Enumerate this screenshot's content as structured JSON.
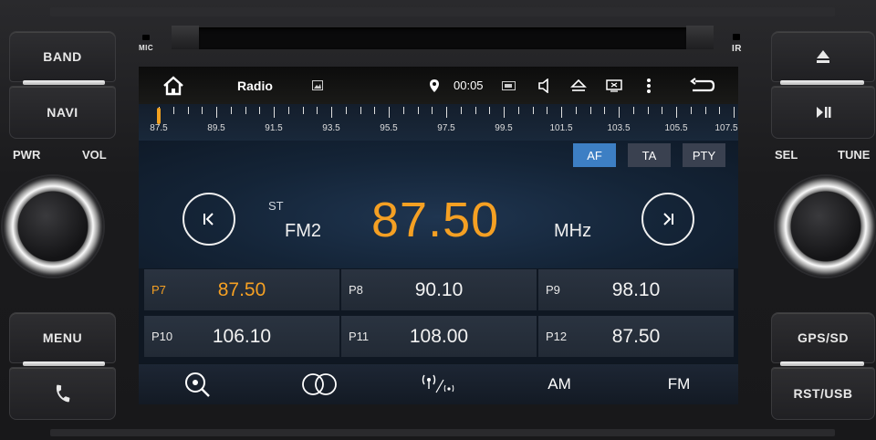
{
  "hardware": {
    "band": "BAND",
    "navi": "NAVI",
    "pwr": "PWR",
    "vol": "VOL",
    "menu": "MENU",
    "mic": "MIC",
    "ir": "IR",
    "sel": "SEL",
    "tune": "TUNE",
    "gps_sd": "GPS/SD",
    "rst_usb": "RST/USB",
    "eject_icon": "eject-icon",
    "play_pause_icon": "play-pause-icon",
    "phone_icon": "phone-icon"
  },
  "statusbar": {
    "title": "Radio",
    "time": "00:05",
    "icons": [
      "home-icon",
      "image-icon",
      "location-pin-icon",
      "battery-icon",
      "volume-icon",
      "eject-icon",
      "screen-icon",
      "more-icon",
      "back-icon"
    ]
  },
  "dial": {
    "labels": [
      "87.5",
      "89.5",
      "91.5",
      "93.5",
      "95.5",
      "97.5",
      "99.5",
      "101.5",
      "103.5",
      "105.5",
      "107.5"
    ]
  },
  "tags": {
    "af": "AF",
    "ta": "TA",
    "pty": "PTY"
  },
  "tuner": {
    "stereo": "ST",
    "band": "FM2",
    "frequency": "87.50",
    "unit": "MHz"
  },
  "presets": [
    {
      "num": "P7",
      "freq": "87.50",
      "active": true
    },
    {
      "num": "P8",
      "freq": "90.10",
      "active": false
    },
    {
      "num": "P9",
      "freq": "98.10",
      "active": false
    },
    {
      "num": "P10",
      "freq": "106.10",
      "active": false
    },
    {
      "num": "P11",
      "freq": "108.00",
      "active": false
    },
    {
      "num": "P12",
      "freq": "87.50",
      "active": false
    }
  ],
  "bottombar": {
    "am": "AM",
    "fm": "FM",
    "icons": [
      "search-icon",
      "stereo-icon",
      "broadcast-icon"
    ]
  },
  "colors": {
    "accent": "#f5a023",
    "af_active": "#3d7fc4",
    "tag_inactive": "#3a4150"
  }
}
